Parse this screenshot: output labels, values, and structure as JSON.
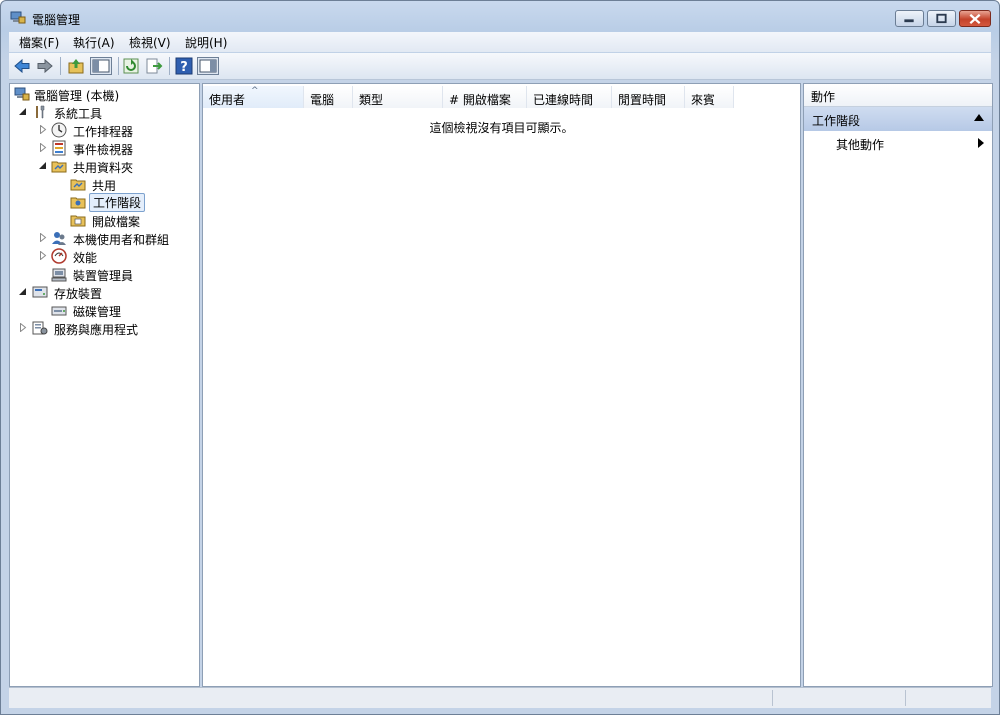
{
  "window": {
    "title": "電腦管理"
  },
  "menubar": {
    "items": [
      {
        "label": "檔案(F)"
      },
      {
        "label": "執行(A)"
      },
      {
        "label": "檢視(V)"
      },
      {
        "label": "說明(H)"
      }
    ]
  },
  "toolbar": {
    "buttons": [
      "back-icon",
      "forward-icon",
      "up-folder-icon",
      "show-hide-tree-icon",
      "refresh-icon",
      "export-list-icon",
      "help-icon",
      "show-hide-action-pane-icon"
    ]
  },
  "tree": {
    "items": [
      {
        "label": "電腦管理 (本機)",
        "icon": "computer-management-icon",
        "expander": "none",
        "selected": false
      },
      {
        "label": "系統工具",
        "icon": "system-tools-icon",
        "expander": "expanded",
        "selected": false
      },
      {
        "label": "工作排程器",
        "icon": "task-scheduler-icon",
        "expander": "collapsed",
        "selected": false
      },
      {
        "label": "事件檢視器",
        "icon": "event-viewer-icon",
        "expander": "collapsed",
        "selected": false
      },
      {
        "label": "共用資料夾",
        "icon": "shared-folders-icon",
        "expander": "expanded",
        "selected": false
      },
      {
        "label": "共用",
        "icon": "shares-icon",
        "expander": "none",
        "selected": false
      },
      {
        "label": "工作階段",
        "icon": "sessions-icon",
        "expander": "none",
        "selected": true
      },
      {
        "label": "開啟檔案",
        "icon": "open-files-icon",
        "expander": "none",
        "selected": false
      },
      {
        "label": "本機使用者和群組",
        "icon": "local-users-groups-icon",
        "expander": "collapsed",
        "selected": false
      },
      {
        "label": "效能",
        "icon": "performance-icon",
        "expander": "collapsed",
        "selected": false
      },
      {
        "label": "裝置管理員",
        "icon": "device-manager-icon",
        "expander": "none",
        "selected": false
      },
      {
        "label": "存放裝置",
        "icon": "storage-icon",
        "expander": "expanded",
        "selected": false
      },
      {
        "label": "磁碟管理",
        "icon": "disk-management-icon",
        "expander": "none",
        "selected": false
      },
      {
        "label": "服務與應用程式",
        "icon": "services-applications-icon",
        "expander": "collapsed",
        "selected": false
      }
    ]
  },
  "list": {
    "columns": [
      {
        "label": "使用者",
        "sorted": true
      },
      {
        "label": "電腦",
        "sorted": false
      },
      {
        "label": "類型",
        "sorted": false
      },
      {
        "label": "# 開啟檔案",
        "sorted": false
      },
      {
        "label": "已連線時間",
        "sorted": false
      },
      {
        "label": "閒置時間",
        "sorted": false
      },
      {
        "label": "來賓",
        "sorted": false
      }
    ],
    "empty_message": "這個檢視沒有項目可顯示。"
  },
  "actions": {
    "header": "動作",
    "section_title": "工作階段",
    "items": [
      {
        "label": "其他動作"
      }
    ]
  },
  "colors": {
    "selection_border": "#7da2ce",
    "selection_fill": "#e4eefb",
    "section_bg": "#c3d4ec",
    "close_button": "#c4432b"
  }
}
